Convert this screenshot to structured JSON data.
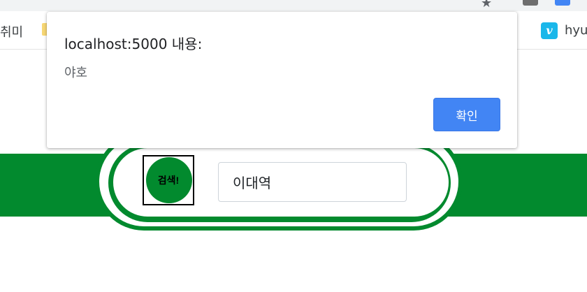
{
  "browser": {
    "bookmarks": {
      "left_item": "취미",
      "vimeo_glyph": "v",
      "right_item": "hyu"
    },
    "icons": [
      "star-icon",
      "folder-icon",
      "vimeo-icon",
      "extension-icon"
    ]
  },
  "page": {
    "search_button_label": "검색!",
    "search_input_value": "이대역",
    "colors": {
      "brand_green": "#028a2e",
      "dialog_button": "#4285f4"
    }
  },
  "dialog": {
    "title": "localhost:5000 내용:",
    "message": "야호",
    "ok_label": "확인"
  }
}
